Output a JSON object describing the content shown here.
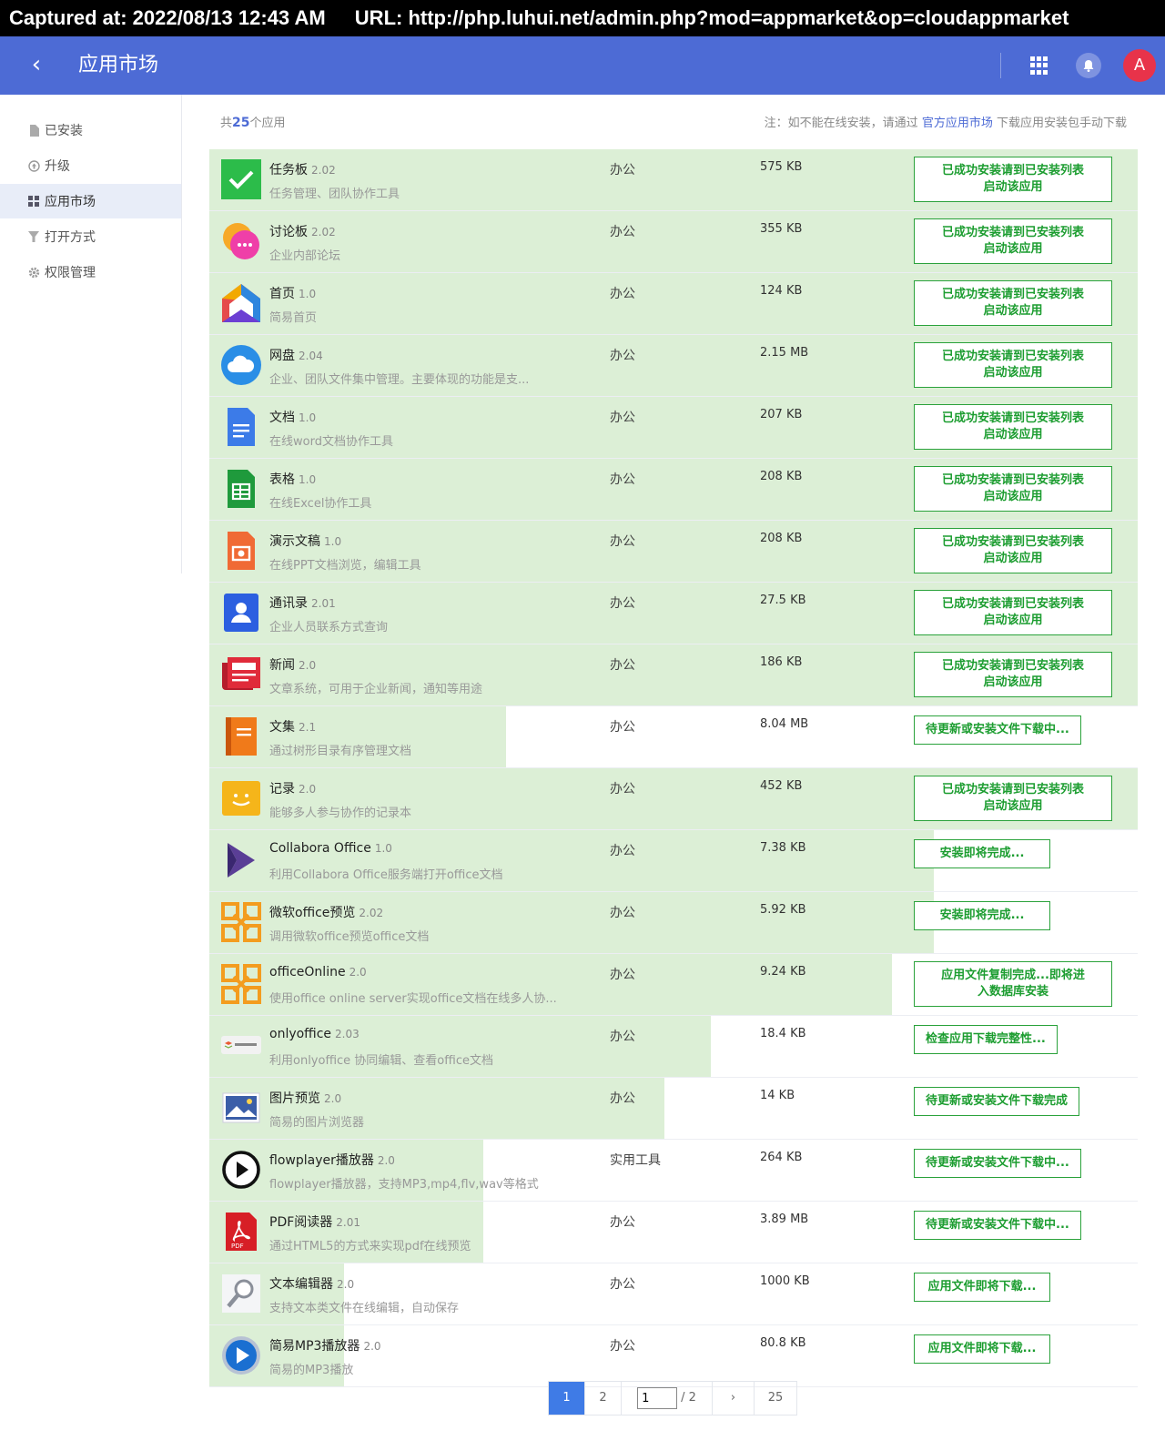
{
  "capture": {
    "time": "Captured at: 2022/08/13 12:43 AM",
    "url": "URL: http://php.luhui.net/admin.php?mod=appmarket&op=cloudappmarket"
  },
  "header": {
    "back": "‹",
    "title": "应用市场",
    "avatar": "A"
  },
  "sidebar": {
    "items": [
      {
        "label": "已安装"
      },
      {
        "label": "升级"
      },
      {
        "label": "应用市场"
      },
      {
        "label": "打开方式"
      },
      {
        "label": "权限管理"
      }
    ]
  },
  "summary": {
    "prefix": "共",
    "count": "25",
    "suffix": "个应用"
  },
  "note": {
    "prefix": "注：如不能在线安装，请通过",
    "link": "官方应用市场",
    "suffix": "下载应用安装包手动下载"
  },
  "apps": [
    {
      "name": "任务板",
      "version": "2.02",
      "desc": "任务管理、团队协作工具",
      "category": "办公",
      "size": "575 KB",
      "action1": "已成功安装请到已安装列表",
      "action2": "启动该应用",
      "progress": 1.0,
      "icon": "task-board-icon",
      "color": "#2cbc4a"
    },
    {
      "name": "讨论板",
      "version": "2.02",
      "desc": "企业内部论坛",
      "category": "办公",
      "size": "355 KB",
      "action1": "已成功安装请到已安装列表",
      "action2": "启动该应用",
      "progress": 1.0,
      "icon": "discussion-board-icon",
      "color": "#ef3fa8"
    },
    {
      "name": "首页",
      "version": "1.0",
      "desc": "简易首页",
      "category": "办公",
      "size": "124 KB",
      "action1": "已成功安装请到已安装列表",
      "action2": "启动该应用",
      "progress": 1.0,
      "icon": "homepage-icon",
      "color": "#f2a900"
    },
    {
      "name": "网盘",
      "version": "2.04",
      "desc": "企业、团队文件集中管理。主要体现的功能是支...",
      "category": "办公",
      "size": "2.15 MB",
      "action1": "已成功安装请到已安装列表",
      "action2": "启动该应用",
      "progress": 1.0,
      "icon": "cloud-drive-icon",
      "color": "#2a8ee6"
    },
    {
      "name": "文档",
      "version": "1.0",
      "desc": "在线word文档协作工具",
      "category": "办公",
      "size": "207 KB",
      "action1": "已成功安装请到已安装列表",
      "action2": "启动该应用",
      "progress": 1.0,
      "icon": "document-icon",
      "color": "#3c7be8"
    },
    {
      "name": "表格",
      "version": "1.0",
      "desc": "在线Excel协作工具",
      "category": "办公",
      "size": "208 KB",
      "action1": "已成功安装请到已安装列表",
      "action2": "启动该应用",
      "progress": 1.0,
      "icon": "spreadsheet-icon",
      "color": "#1f9a3c"
    },
    {
      "name": "演示文稿",
      "version": "1.0",
      "desc": "在线PPT文档浏览，编辑工具",
      "category": "办公",
      "size": "208 KB",
      "action1": "已成功安装请到已安装列表",
      "action2": "启动该应用",
      "progress": 1.0,
      "icon": "presentation-icon",
      "color": "#f06a35"
    },
    {
      "name": "通讯录",
      "version": "2.01",
      "desc": "企业人员联系方式查询",
      "category": "办公",
      "size": "27.5 KB",
      "action1": "已成功安装请到已安装列表",
      "action2": "启动该应用",
      "progress": 1.0,
      "icon": "contacts-icon",
      "color": "#2c5fe0"
    },
    {
      "name": "新闻",
      "version": "2.0",
      "desc": "文章系统，可用于企业新闻，通知等用途",
      "category": "办公",
      "size": "186 KB",
      "action1": "已成功安装请到已安装列表",
      "action2": "启动该应用",
      "progress": 1.0,
      "icon": "news-icon",
      "color": "#e02b3a"
    },
    {
      "name": "文集",
      "version": "2.1",
      "desc": "通过树形目录有序管理文档",
      "category": "办公",
      "size": "8.04 MB",
      "action1": "待更新或安装文件下载中...",
      "action2": "",
      "progress": 0.32,
      "icon": "anthology-icon",
      "color": "#f07a1a"
    },
    {
      "name": "记录",
      "version": "2.0",
      "desc": "能够多人参与协作的记录本",
      "category": "办公",
      "size": "452 KB",
      "action1": "已成功安装请到已安装列表",
      "action2": "启动该应用",
      "progress": 1.0,
      "icon": "record-icon",
      "color": "#f5b51a"
    },
    {
      "name": "Collabora Office",
      "version": "1.0",
      "desc": "利用Collabora Office服务端打开office文档",
      "category": "办公",
      "size": "7.38 KB",
      "action1": "安装即将完成...",
      "action2": "",
      "progress": 0.78,
      "icon": "collabora-office-icon",
      "color": "#5a3e96"
    },
    {
      "name": "微软office预览",
      "version": "2.02",
      "desc": "调用微软office预览office文档",
      "category": "办公",
      "size": "5.92 KB",
      "action1": "安装即将完成...",
      "action2": "",
      "progress": 0.78,
      "icon": "ms-office-preview-icon",
      "color": "#f39c1f"
    },
    {
      "name": "officeOnline",
      "version": "2.0",
      "desc": "使用office online server实现office文档在线多人协...",
      "category": "办公",
      "size": "9.24 KB",
      "action1": "应用文件复制完成...即将进",
      "action2": "入数据库安装",
      "progress": 0.735,
      "icon": "office-online-icon",
      "color": "#f39c1f"
    },
    {
      "name": "onlyoffice",
      "version": "2.03",
      "desc": "利用onlyoffice 协同编辑、查看office文档",
      "category": "办公",
      "size": "18.4 KB",
      "action1": "检查应用下载完整性...",
      "action2": "",
      "progress": 0.54,
      "icon": "onlyoffice-icon",
      "color": "#ea5a33"
    },
    {
      "name": "图片预览",
      "version": "2.0",
      "desc": "简易的图片浏览器",
      "category": "办公",
      "size": "14 KB",
      "action1": "待更新或安装文件下载完成",
      "action2": "",
      "progress": 0.49,
      "icon": "image-preview-icon",
      "color": "#3b5ea8"
    },
    {
      "name": "flowplayer播放器",
      "version": "2.0",
      "desc": "flowplayer播放器，支持MP3,mp4,flv,wav等格式",
      "category": "实用工具",
      "size": "264 KB",
      "action1": "待更新或安装文件下载中...",
      "action2": "",
      "progress": 0.295,
      "icon": "flowplayer-icon",
      "color": "#111111"
    },
    {
      "name": "PDF阅读器",
      "version": "2.01",
      "desc": "通过HTML5的方式来实现pdf在线预览",
      "category": "办公",
      "size": "3.89 MB",
      "action1": "待更新或安装文件下载中...",
      "action2": "",
      "progress": 0.295,
      "icon": "pdf-reader-icon",
      "color": "#d71f26"
    },
    {
      "name": "文本编辑器",
      "version": "2.0",
      "desc": "支持文本类文件在线编辑，自动保存",
      "category": "办公",
      "size": "1000 KB",
      "action1": "应用文件即将下载...",
      "action2": "",
      "progress": 0.145,
      "icon": "text-editor-icon",
      "color": "#8a8f99"
    },
    {
      "name": "简易MP3播放器",
      "version": "2.0",
      "desc": "简易的MP3播放",
      "category": "办公",
      "size": "80.8 KB",
      "action1": "应用文件即将下载...",
      "action2": "",
      "progress": 0.145,
      "icon": "mp3-player-icon",
      "color": "#1a6fd1"
    }
  ],
  "pager": {
    "current": "1",
    "page2": "2",
    "jump_value": "1",
    "of_total": "/ 2",
    "next": "›",
    "total": "25"
  }
}
